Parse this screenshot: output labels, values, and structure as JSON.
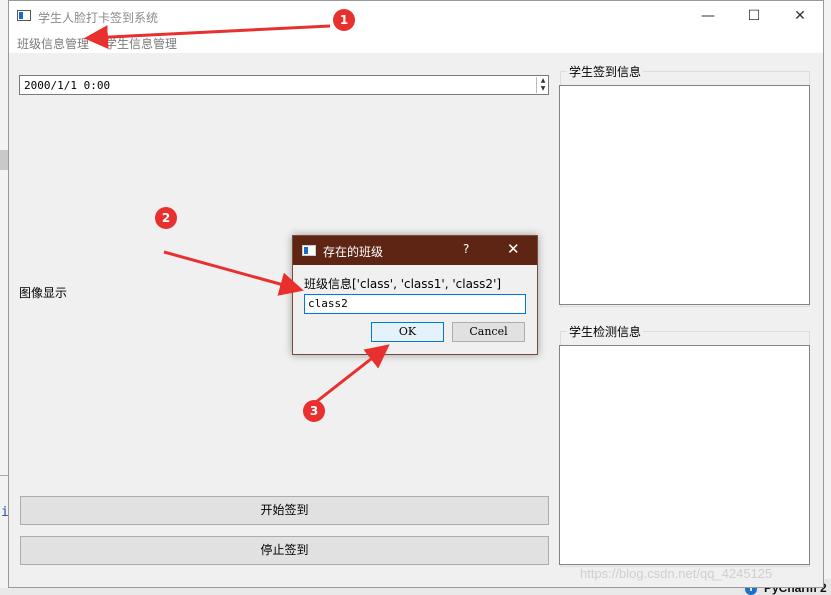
{
  "window": {
    "title": "学生人脸打卡签到系统",
    "controls": [
      "—",
      "☐",
      "✕"
    ]
  },
  "menu": {
    "items": [
      "班级信息管理",
      "学生信息管理"
    ]
  },
  "datetime": {
    "value": "2000/1/1 0:00"
  },
  "image_display_label": "图像显示",
  "buttons": {
    "start": "开始签到",
    "stop": "停止签到"
  },
  "groups": {
    "signin_info": "学生签到信息",
    "detect_info": "学生检测信息"
  },
  "dialog": {
    "title": "存在的班级",
    "help": "?",
    "close": "✕",
    "label": "班级信息['class', 'class1', 'class2']",
    "input_value": "class2",
    "ok": "OK",
    "cancel": "Cancel"
  },
  "annotations": {
    "badges": [
      "1",
      "2",
      "3"
    ],
    "color": "#e8302e"
  },
  "watermark": "https://blog.csdn.net/qq_4245125",
  "taskbar": {
    "label": "PyCharm 2",
    "icon_glyph": "i"
  }
}
